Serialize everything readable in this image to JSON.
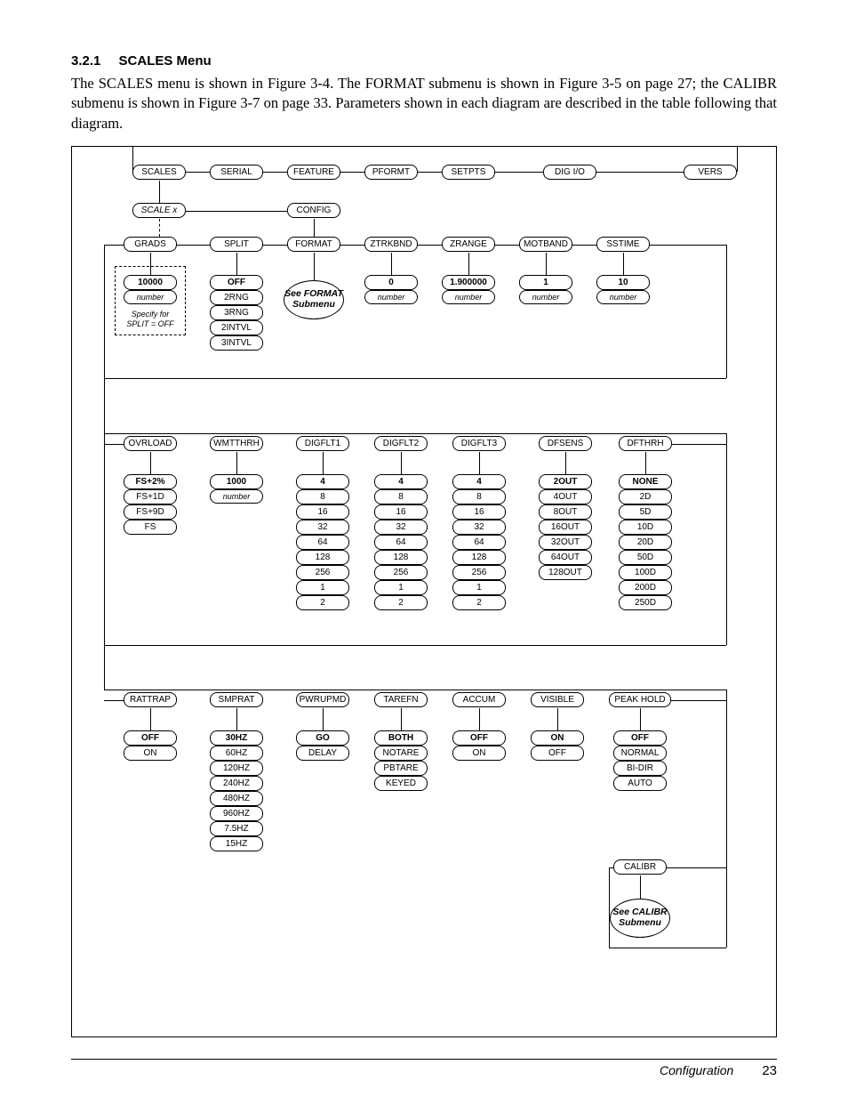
{
  "heading": {
    "num": "3.2.1",
    "title": "SCALES Menu"
  },
  "para": "The SCALES menu is shown in Figure 3-4. The FORMAT submenu is shown in Figure 3-5 on page 27; the CALIBR submenu is shown in Figure 3-7 on page 33. Parameters shown in each diagram are described in the table following that diagram.",
  "top_menu": [
    "SCALES",
    "SERIAL",
    "FEATURE",
    "PFORMT",
    "SETPTS",
    "DIG I/O",
    "VERS"
  ],
  "row2": {
    "left": "SCALE x",
    "right": "CONFIG"
  },
  "row3": [
    "GRADS",
    "SPLIT",
    "FORMAT",
    "ZTRKBND",
    "ZRANGE",
    "MOTBAND",
    "SSTIME"
  ],
  "row3v": {
    "grads": {
      "bold": "10000",
      "ital": "number"
    },
    "split": {
      "bold": "OFF",
      "vals": [
        "2RNG",
        "3RNG",
        "2INTVL",
        "3INTVL"
      ]
    },
    "ztrkbnd": {
      "bold": "0",
      "ital": "number"
    },
    "zrange": {
      "bold": "1.900000",
      "ital": "number"
    },
    "motband": {
      "bold": "1",
      "ital": "number"
    },
    "sstime": {
      "bold": "10",
      "ital": "number"
    }
  },
  "note_box": "Specify for SPLIT = OFF",
  "oval_fmt": "See FORMAT Submenu",
  "row4": [
    "OVRLOAD",
    "WMTTHRH",
    "DIGFLT1",
    "DIGFLT2",
    "DIGFLT3",
    "DFSENS",
    "DFTHRH"
  ],
  "row4v": {
    "ovrload": {
      "bold": "FS+2%",
      "vals": [
        "FS+1D",
        "FS+9D",
        "FS"
      ]
    },
    "wmtthrh": {
      "bold": "1000",
      "ital": "number"
    },
    "digflt": {
      "bold": "4",
      "vals": [
        "8",
        "16",
        "32",
        "64",
        "128",
        "256",
        "1",
        "2"
      ]
    },
    "dfsens": {
      "bold": "2OUT",
      "vals": [
        "4OUT",
        "8OUT",
        "16OUT",
        "32OUT",
        "64OUT",
        "128OUT"
      ]
    },
    "dfthrh": {
      "bold": "NONE",
      "vals": [
        "2D",
        "5D",
        "10D",
        "20D",
        "50D",
        "100D",
        "200D",
        "250D"
      ]
    }
  },
  "row5": [
    "RATTRAP",
    "SMPRAT",
    "PWRUPMD",
    "TAREFN",
    "ACCUM",
    "VISIBLE",
    "PEAK HOLD"
  ],
  "row5v": {
    "rattrap": {
      "bold": "OFF",
      "vals": [
        "ON"
      ]
    },
    "smprat": {
      "bold": "30HZ",
      "vals": [
        "60HZ",
        "120HZ",
        "240HZ",
        "480HZ",
        "960HZ",
        "7.5HZ",
        "15HZ"
      ]
    },
    "pwrupmd": {
      "bold": "GO",
      "vals": [
        "DELAY"
      ]
    },
    "tarefn": {
      "bold": "BOTH",
      "vals": [
        "NOTARE",
        "PBTARE",
        "KEYED"
      ]
    },
    "accum": {
      "bold": "OFF",
      "vals": [
        "ON"
      ]
    },
    "visible": {
      "bold": "ON",
      "vals": [
        "OFF"
      ]
    },
    "peak": {
      "bold": "OFF",
      "vals": [
        "NORMAL",
        "BI-DIR",
        "AUTO"
      ]
    }
  },
  "calibr": "CALIBR",
  "oval_cal": "See CALIBR Submenu",
  "footer": {
    "section": "Configuration",
    "page": "23"
  },
  "chart_data": {
    "type": "tree",
    "note": "Menu hierarchy diagram — see structured keys above (top_menu, row2..row5, calibr) for nodes and option lists."
  }
}
